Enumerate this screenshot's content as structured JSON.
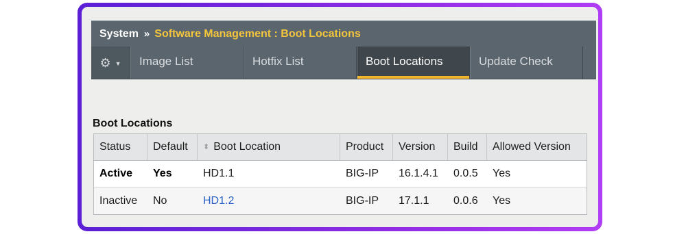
{
  "header": {
    "root": "System",
    "separator": "»",
    "current": "Software Management : Boot Locations"
  },
  "tabs": {
    "menu_icon": "gear-icon",
    "items": [
      {
        "label": "Image List"
      },
      {
        "label": "Hotfix List"
      },
      {
        "label": "Boot Locations",
        "active": true
      },
      {
        "label": "Update Check"
      }
    ]
  },
  "section": {
    "title": "Boot Locations"
  },
  "table": {
    "columns": [
      "Status",
      "Default",
      "Boot Location",
      "Product",
      "Version",
      "Build",
      "Allowed Version"
    ],
    "rows": [
      {
        "status": "Active",
        "default": "Yes",
        "boot_location": "HD1.1",
        "product": "BIG-IP",
        "version": "16.1.4.1",
        "build": "0.0.5",
        "allowed": "Yes"
      },
      {
        "status": "Inactive",
        "default": "No",
        "boot_location": "HD1.2",
        "product": "BIG-IP",
        "version": "17.1.1",
        "build": "0.0.6",
        "allowed": "Yes"
      }
    ]
  },
  "colors": {
    "frame_start": "#5a1fd6",
    "frame_end": "#b13cf5",
    "header_bg": "#5b656d",
    "accent": "#f2c53d",
    "link": "#2a62c9"
  }
}
